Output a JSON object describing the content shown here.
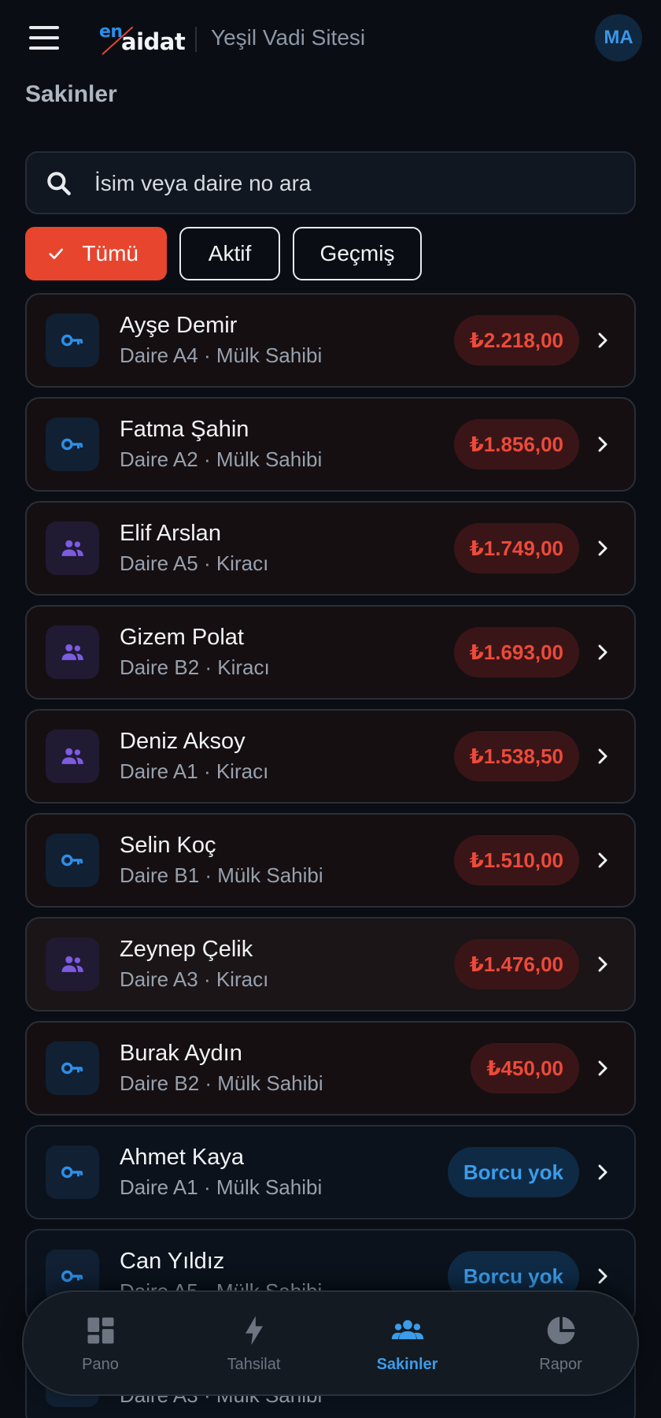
{
  "header": {
    "logo_en": "en",
    "logo_aidat": "aidat",
    "site_name": "Yeşil Vadi Sitesi",
    "avatar_initials": "MA"
  },
  "page": {
    "title": "Sakinler"
  },
  "search": {
    "placeholder": "İsim veya daire no ara",
    "value": ""
  },
  "filters": {
    "all_label": "Tümü",
    "active_label": "Aktif",
    "past_label": "Geçmiş",
    "selected": "Tümü"
  },
  "residents": [
    {
      "name": "Ayşe Demir",
      "detail": "Daire A4 · Mülk Sahibi",
      "type": "owner",
      "balance": "₺2.218,00",
      "status": "debt"
    },
    {
      "name": "Fatma Şahin",
      "detail": "Daire A2 · Mülk Sahibi",
      "type": "owner",
      "balance": "₺1.856,00",
      "status": "debt"
    },
    {
      "name": "Elif Arslan",
      "detail": "Daire A5 · Kiracı",
      "type": "tenant",
      "balance": "₺1.749,00",
      "status": "debt"
    },
    {
      "name": "Gizem Polat",
      "detail": "Daire B2 · Kiracı",
      "type": "tenant",
      "balance": "₺1.693,00",
      "status": "debt"
    },
    {
      "name": "Deniz Aksoy",
      "detail": "Daire A1 · Kiracı",
      "type": "tenant",
      "balance": "₺1.538,50",
      "status": "debt"
    },
    {
      "name": "Selin Koç",
      "detail": "Daire B1 · Mülk Sahibi",
      "type": "owner",
      "balance": "₺1.510,00",
      "status": "debt"
    },
    {
      "name": "Zeynep Çelik",
      "detail": "Daire A3 · Kiracı",
      "type": "tenant",
      "balance": "₺1.476,00",
      "status": "debt"
    },
    {
      "name": "Burak Aydın",
      "detail": "Daire B2 · Mülk Sahibi",
      "type": "owner",
      "balance": "₺450,00",
      "status": "debt"
    },
    {
      "name": "Ahmet Kaya",
      "detail": "Daire A1 · Mülk Sahibi",
      "type": "owner",
      "balance": "Borcu yok",
      "status": "none"
    },
    {
      "name": "Can Yıldız",
      "detail": "Daire A5 · Mülk Sahibi",
      "type": "owner",
      "balance": "Borcu yok",
      "status": "none"
    },
    {
      "name": "",
      "detail": "Daire A3 · Mülk Sahibi",
      "type": "owner",
      "balance": "",
      "status": "none"
    }
  ],
  "bottom_nav": {
    "items": [
      {
        "label": "Pano",
        "icon": "dashboard-icon"
      },
      {
        "label": "Tahsilat",
        "icon": "bolt-icon"
      },
      {
        "label": "Sakinler",
        "icon": "people-icon",
        "active": true
      },
      {
        "label": "Rapor",
        "icon": "pie-chart-icon"
      }
    ]
  },
  "colors": {
    "accent": "#e8452f",
    "debt_text": "#ec4a3a",
    "no_debt_text": "#3b9ce9",
    "owner_icon": "#2b8fe8",
    "tenant_icon": "#7b5ce0"
  }
}
